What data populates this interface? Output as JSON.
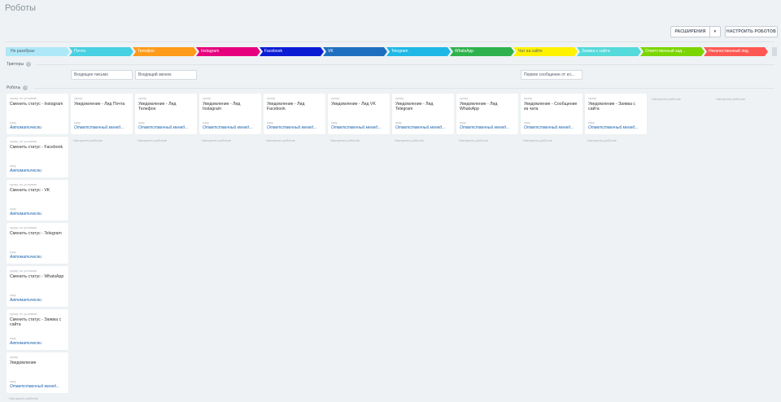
{
  "page": {
    "title": "Роботы"
  },
  "toolbar": {
    "extensions_label": "РАСШИРЕНИЯ",
    "extensions_arrow": "▾",
    "configure_label": "НАСТРОИТЬ РОБОТОВ"
  },
  "stages": [
    {
      "label": "Не разобран",
      "color": "#aee8f7",
      "text_color": "#535c69"
    },
    {
      "label": "Почта",
      "color": "#47d1e2",
      "text_color": "#ffffff"
    },
    {
      "label": "Телефон",
      "color": "#ff9b1a",
      "text_color": "#ffffff"
    },
    {
      "label": "Instagram",
      "color": "#e6007e",
      "text_color": "#ffffff"
    },
    {
      "label": "Facebook",
      "color": "#0a1cd4",
      "text_color": "#ffffff"
    },
    {
      "label": "VK",
      "color": "#1f6fc0",
      "text_color": "#ffffff"
    },
    {
      "label": "Telegram",
      "color": "#1eb8e6",
      "text_color": "#ffffff"
    },
    {
      "label": "WhatsApp",
      "color": "#2fb24d",
      "text_color": "#ffffff"
    },
    {
      "label": "Чат на сайте",
      "color": "#fff200",
      "text_color": "#535c69"
    },
    {
      "label": "Заявка с сайта",
      "color": "#55dadb",
      "text_color": "#ffffff"
    },
    {
      "label": "Ответственный зад...",
      "color": "#7bd500",
      "text_color": "#ffffff"
    },
    {
      "label": "Некачественный лид",
      "color": "#ff5752",
      "text_color": "#ffffff"
    }
  ],
  "triggers": {
    "label": "Триггеры",
    "items": [
      {
        "label": "Входящее письмо"
      },
      {
        "label": "Входящий звонок"
      },
      {
        "label": "Первое сообщение от кл..."
      }
    ]
  },
  "robots": {
    "label": "Роботы",
    "configure_link": "Настроить роботов",
    "first_column": [
      {
        "delay": "сразу, по условию",
        "title": "Сменить статус - Instagram",
        "who_label": "кому",
        "who": "Автоматически"
      },
      {
        "delay": "сразу, по условию",
        "title": "Сменить статус - Facebook",
        "who_label": "кому",
        "who": "Автоматически"
      },
      {
        "delay": "сразу, по условию",
        "title": "Сменить статус - VK",
        "who_label": "кому",
        "who": "Автоматически"
      },
      {
        "delay": "сразу, по условию",
        "title": "Сменить статус - Telegram",
        "who_label": "кому",
        "who": "Автоматически"
      },
      {
        "delay": "сразу, по условию",
        "title": "Сменить статус - WhatsApp",
        "who_label": "кому",
        "who": "Автоматически"
      },
      {
        "delay": "сразу, по условию",
        "title": "Сменить статус - Заявка с сайта",
        "who_label": "кому",
        "who": "Автоматически"
      },
      {
        "delay": "сразу",
        "title": "Уведомление",
        "who_label": "кому",
        "who": "Ответственный менед..."
      }
    ],
    "stage_cards": [
      {
        "delay": "сразу",
        "title": "Уведомление - Лид Почта",
        "who_label": "кому",
        "who": "Ответственный менед..."
      },
      {
        "delay": "сразу",
        "title": "Уведомление - Лид Телефон",
        "who_label": "кому",
        "who": "Ответственный менед..."
      },
      {
        "delay": "сразу",
        "title": "Уведомление - Лид Instagram",
        "who_label": "кому",
        "who": "Ответственный менед..."
      },
      {
        "delay": "сразу",
        "title": "Уведомление - Лид Facebook",
        "who_label": "кому",
        "who": "Ответственный менед..."
      },
      {
        "delay": "сразу",
        "title": "Уведомление - Лид VK",
        "who_label": "кому",
        "who": "Ответственный менед..."
      },
      {
        "delay": "сразу",
        "title": "Уведомление - Лид Telegram",
        "who_label": "кому",
        "who": "Ответственный менед..."
      },
      {
        "delay": "сразу",
        "title": "Уведомление - Лид WhatsApp",
        "who_label": "кому",
        "who": "Ответственный менед..."
      },
      {
        "delay": "сразу",
        "title": "Уведомление - Сообщение из чата",
        "who_label": "кому",
        "who": "Ответственный менед..."
      },
      {
        "delay": "сразу",
        "title": "Уведомление - Заявка с сайта",
        "who_label": "кому",
        "who": "Ответственный менед..."
      }
    ]
  }
}
